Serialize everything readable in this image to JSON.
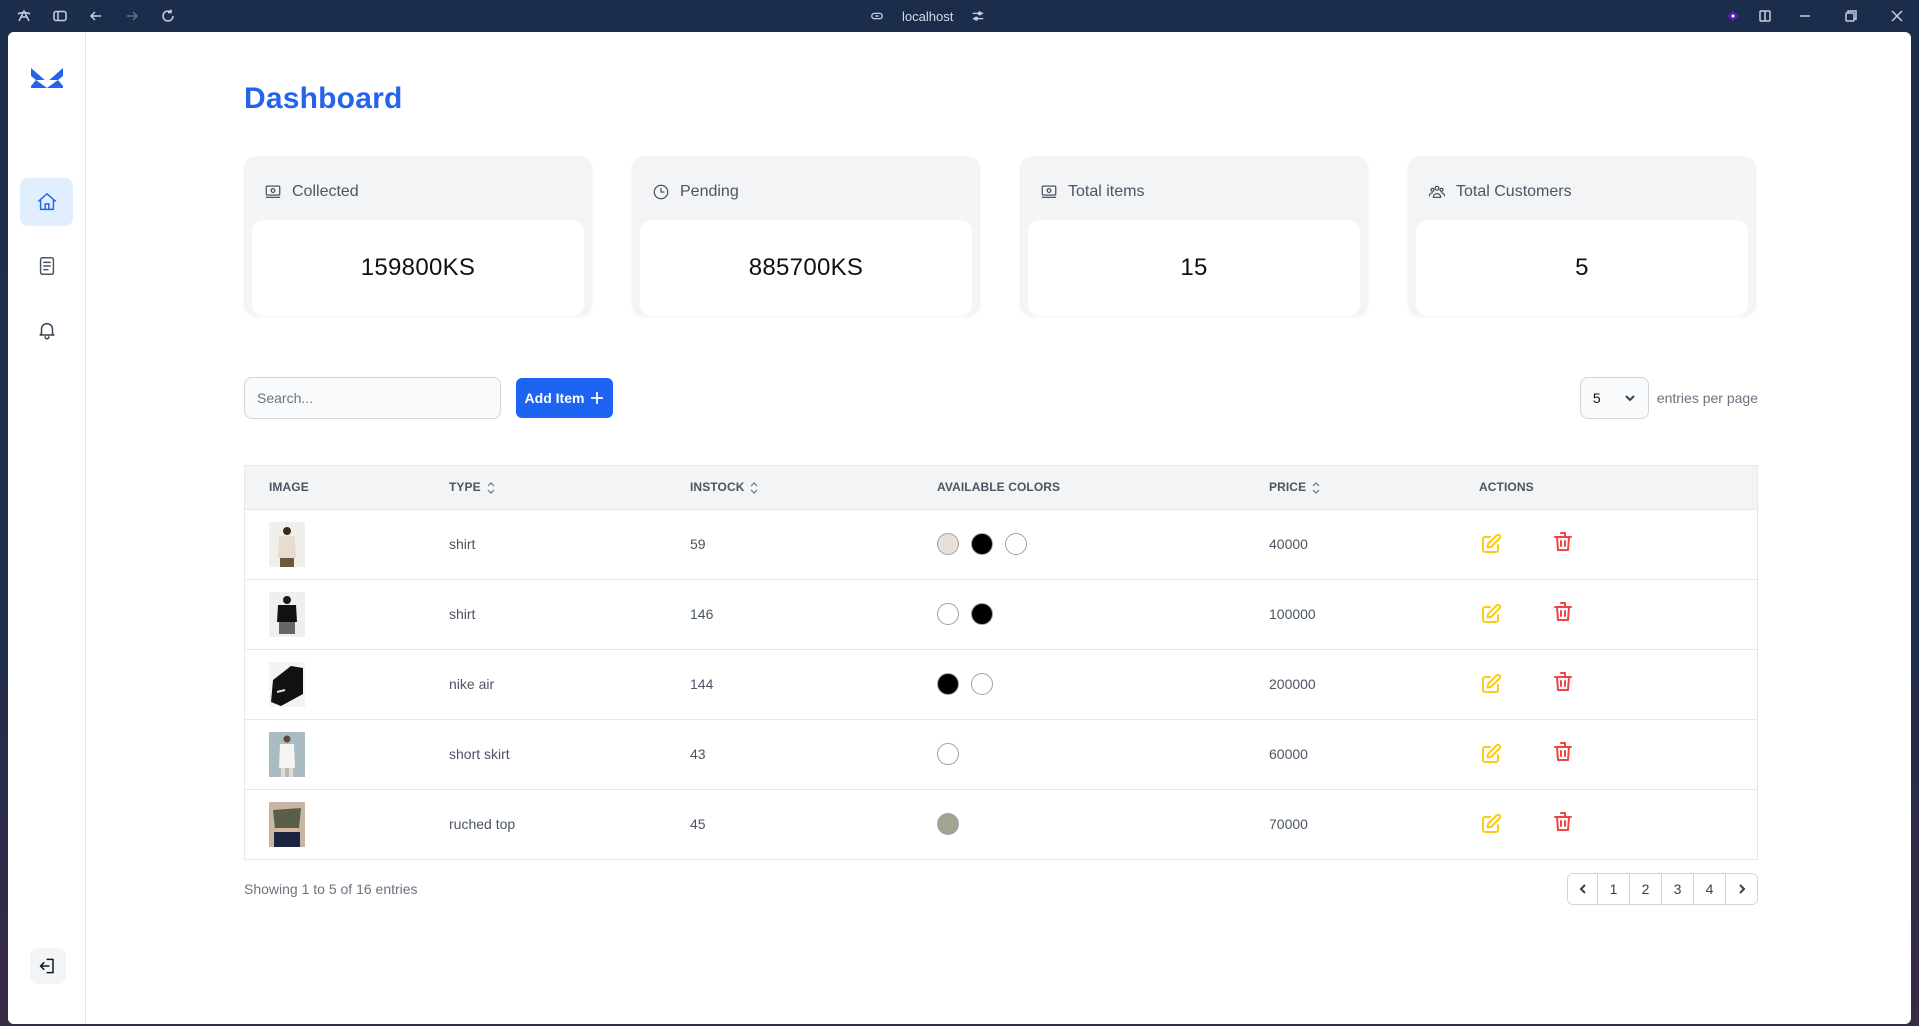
{
  "browser": {
    "address": "localhost"
  },
  "sidebar": {
    "items": [
      {
        "id": "home",
        "icon": "home-icon",
        "active": true
      },
      {
        "id": "documents",
        "icon": "document-icon",
        "active": false
      },
      {
        "id": "notifications",
        "icon": "bell-icon",
        "active": false
      }
    ],
    "logout_icon": "logout-icon"
  },
  "page": {
    "title": "Dashboard"
  },
  "cards": [
    {
      "label": "Collected",
      "value": "159800KS",
      "icon": "banknotes-icon"
    },
    {
      "label": "Pending",
      "value": "885700KS",
      "icon": "clock-icon"
    },
    {
      "label": "Total items",
      "value": "15",
      "icon": "banknotes-icon"
    },
    {
      "label": "Total Customers",
      "value": "5",
      "icon": "users-icon"
    }
  ],
  "toolbar": {
    "search_placeholder": "Search...",
    "search_value": "",
    "add_label": "Add Item",
    "per_page_value": "5",
    "per_page_label": "entries per page"
  },
  "table": {
    "columns": [
      "Image",
      "Type",
      "Instock",
      "Available Colors",
      "Price",
      "Actions"
    ],
    "sortable": [
      false,
      true,
      true,
      false,
      true,
      false
    ],
    "rows": [
      {
        "image": "beige shirt back view",
        "type": "shirt",
        "instock": "59",
        "colors": [
          "#e8e0d6",
          "#000000",
          "#ffffff"
        ],
        "price": "40000"
      },
      {
        "image": "black long-sleeve shirt",
        "type": "shirt",
        "instock": "146",
        "colors": [
          "#ffffff",
          "#000000"
        ],
        "price": "100000"
      },
      {
        "image": "black sneaker",
        "type": "nike air",
        "instock": "144",
        "colors": [
          "#000000",
          "#ffffff"
        ],
        "price": "200000"
      },
      {
        "image": "white skirt outfit",
        "type": "short skirt",
        "instock": "43",
        "colors": [
          "#ffffff"
        ],
        "price": "60000"
      },
      {
        "image": "olive ruched top",
        "type": "ruched top",
        "instock": "45",
        "colors": [
          "#a3a392"
        ],
        "price": "70000"
      }
    ]
  },
  "footer": {
    "showing": "Showing 1 to 5 of 16 entries",
    "pages": [
      "1",
      "2",
      "3",
      "4"
    ]
  },
  "colors": {
    "accent": "#2563eb",
    "button": "#1d64f2",
    "edit": "#facc15",
    "delete": "#ef4444"
  }
}
